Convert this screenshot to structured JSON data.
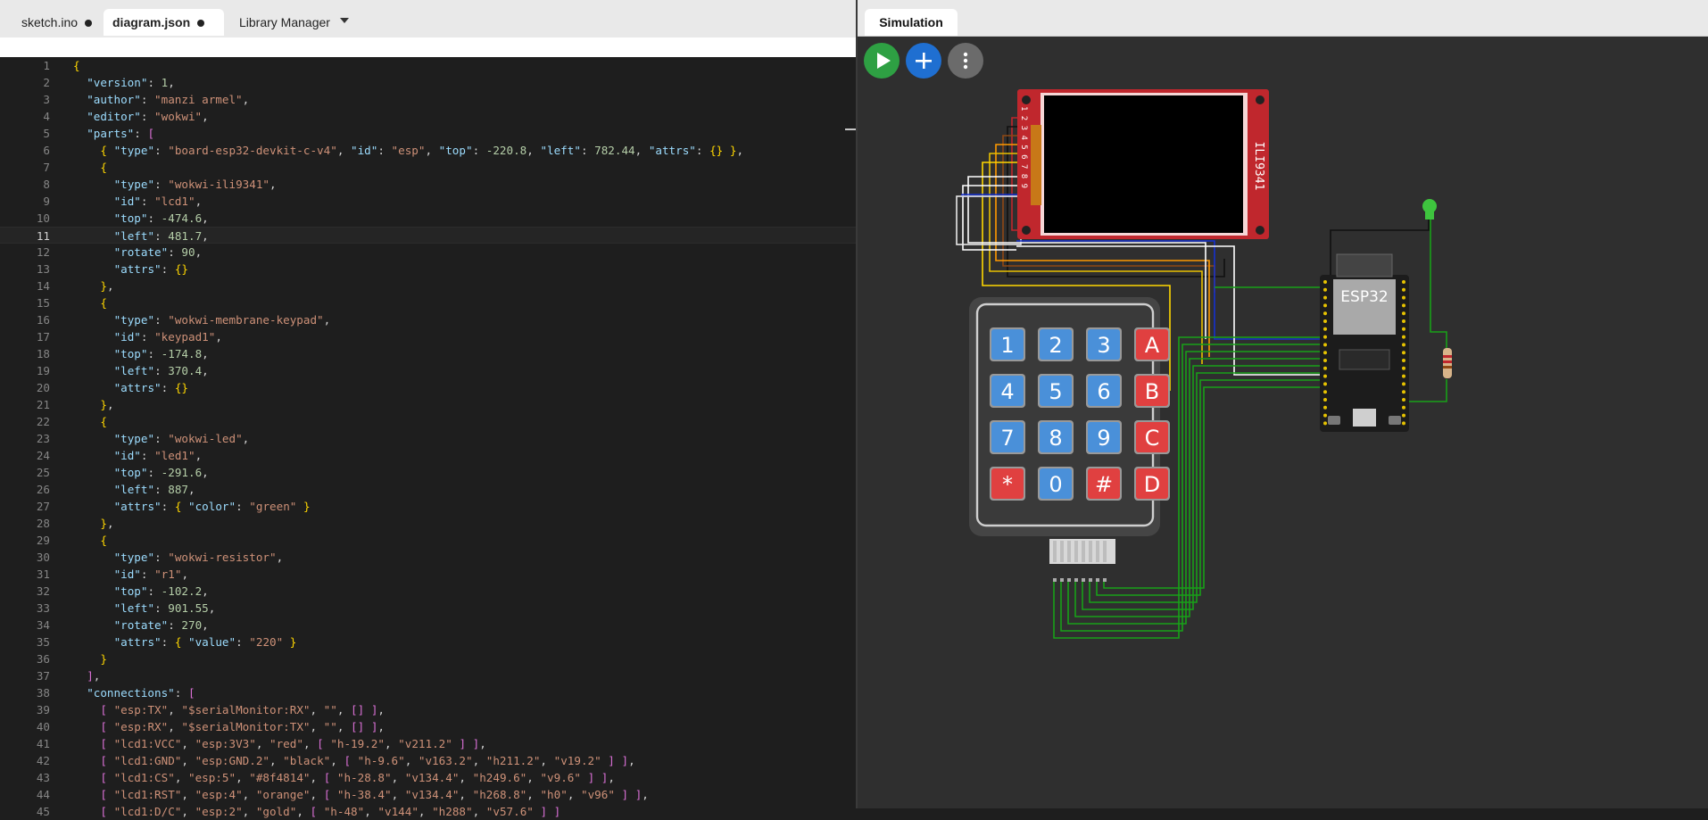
{
  "editor": {
    "tabs": [
      {
        "label": "sketch.ino",
        "dirty": true
      },
      {
        "label": "diagram.json",
        "dirty": true,
        "active": true
      },
      {
        "label": "Library Manager"
      }
    ],
    "active_line": 11,
    "lines": [
      "{",
      "  \"version\": 1,",
      "  \"author\": \"manzi armel\",",
      "  \"editor\": \"wokwi\",",
      "  \"parts\": [",
      "    { \"type\": \"board-esp32-devkit-c-v4\", \"id\": \"esp\", \"top\": -220.8, \"left\": 782.44, \"attrs\": {} },",
      "    {",
      "      \"type\": \"wokwi-ili9341\",",
      "      \"id\": \"lcd1\",",
      "      \"top\": -474.6,",
      "      \"left\": 481.7,",
      "      \"rotate\": 90,",
      "      \"attrs\": {}",
      "    },",
      "    {",
      "      \"type\": \"wokwi-membrane-keypad\",",
      "      \"id\": \"keypad1\",",
      "      \"top\": -174.8,",
      "      \"left\": 370.4,",
      "      \"attrs\": {}",
      "    },",
      "    {",
      "      \"type\": \"wokwi-led\",",
      "      \"id\": \"led1\",",
      "      \"top\": -291.6,",
      "      \"left\": 887,",
      "      \"attrs\": { \"color\": \"green\" }",
      "    },",
      "    {",
      "      \"type\": \"wokwi-resistor\",",
      "      \"id\": \"r1\",",
      "      \"top\": -102.2,",
      "      \"left\": 901.55,",
      "      \"rotate\": 270,",
      "      \"attrs\": { \"value\": \"220\" }",
      "    }",
      "  ],",
      "  \"connections\": [",
      "    [ \"esp:TX\", \"$serialMonitor:RX\", \"\", [] ],",
      "    [ \"esp:RX\", \"$serialMonitor:TX\", \"\", [] ],",
      "    [ \"lcd1:VCC\", \"esp:3V3\", \"red\", [ \"h-19.2\", \"v211.2\" ] ],",
      "    [ \"lcd1:GND\", \"esp:GND.2\", \"black\", [ \"h-9.6\", \"v163.2\", \"h211.2\", \"v19.2\" ] ],",
      "    [ \"lcd1:CS\", \"esp:5\", \"#8f4814\", [ \"h-28.8\", \"v134.4\", \"h249.6\", \"v9.6\" ] ],",
      "    [ \"lcd1:RST\", \"esp:4\", \"orange\", [ \"h-38.4\", \"v134.4\", \"h268.8\", \"h0\", \"v96\" ] ],",
      "    [ \"lcd1:D/C\", \"esp:2\", \"gold\", [ \"h-48\", \"v144\", \"h288\", \"v57.6\" ] ]"
    ]
  },
  "simulation": {
    "tab_label": "Simulation",
    "buttons": [
      "play",
      "add",
      "more"
    ],
    "lcd_label": "ILI9341",
    "lcd_pin_numbers": "1 2 3 4 5 6 7 8 9",
    "esp_label": "ESP32",
    "keypad_keys": [
      [
        "1",
        "2",
        "3",
        "A"
      ],
      [
        "4",
        "5",
        "6",
        "B"
      ],
      [
        "7",
        "8",
        "9",
        "C"
      ],
      [
        "*",
        "0",
        "#",
        "D"
      ]
    ],
    "colors": {
      "key_blue": "#4a90d9",
      "key_red": "#e04040",
      "lcd_board": "#c0272d",
      "led": "#3ec43e",
      "canvas_bg": "#2f2f2f"
    }
  }
}
